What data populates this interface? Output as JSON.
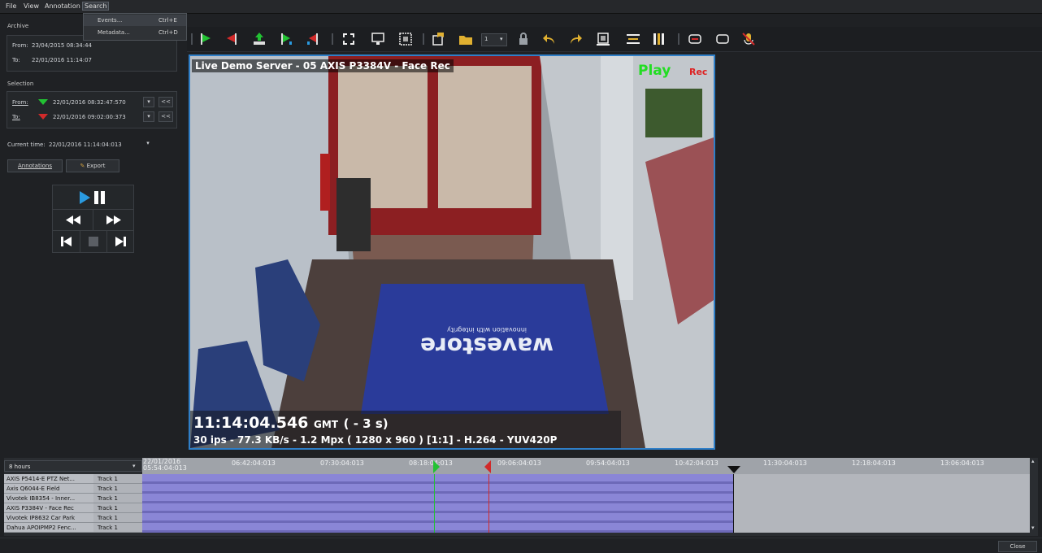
{
  "menubar": {
    "items": [
      "File",
      "View",
      "Annotation",
      "Search"
    ]
  },
  "search_menu": {
    "items": [
      {
        "label": "Events...",
        "shortcut": "Ctrl+E"
      },
      {
        "label": "Metadata...",
        "shortcut": "Ctrl+D"
      }
    ]
  },
  "archive": {
    "title": "Archive",
    "from_label": "From:",
    "from_value": "23/04/2015 08:34:44",
    "to_label": "To:",
    "to_value": "22/01/2016 11:14:07"
  },
  "selection": {
    "title": "Selection",
    "from_label": "From:",
    "from_value": "22/01/2016 08:32:47:570",
    "to_label": "To:",
    "to_value": "22/01/2016 09:02:00:373",
    "jump_label": "<<"
  },
  "current_time": {
    "label": "Current time:",
    "value": "22/01/2016 11:14:04:013"
  },
  "buttons": {
    "annotations": "Annotations",
    "export": "Export"
  },
  "toolbar": {
    "page_value": "1"
  },
  "video": {
    "title": "Live Demo Server - 05 AXIS P3384V - Face Rec",
    "play": "Play",
    "rec": "Rec",
    "time": "11:14:04.546",
    "tz": "GMT",
    "offset": "( - 3 s)",
    "stats": "30 ips - 77.3 KB/s - 1.2 Mpx ( 1280 x 960 ) [1:1] - H.264 - YUV420P",
    "mat_brand": "wavestore",
    "mat_tagline": "innovation with integrity"
  },
  "timeline": {
    "range_value": "8 hours",
    "start_date": "22/01/2016",
    "ticks": [
      "05:54:04:013",
      "06:42:04:013",
      "07:30:04:013",
      "08:18:04:013",
      "09:06:04:013",
      "09:54:04:013",
      "10:42:04:013",
      "11:30:04:013",
      "12:18:04:013",
      "13:06:04:013"
    ],
    "rows": [
      {
        "name": "AXIS P5414-E PTZ Net...",
        "track": "Track 1"
      },
      {
        "name": "Axis Q6044-E Field",
        "track": "Track 1"
      },
      {
        "name": "Vivotek IB8354 - Inner...",
        "track": "Track 1"
      },
      {
        "name": "AXIS P3384V - Face Rec",
        "track": "Track 1"
      },
      {
        "name": "Vivotek IP8632 Car Park",
        "track": "Track 1"
      },
      {
        "name": "Dahua APOIPMP2 Fenc...",
        "track": "Track 1"
      }
    ]
  },
  "footer": {
    "close": "Close"
  },
  "colors": {
    "accent": "#2f7fc8",
    "play": "#22dd22",
    "rec": "#dd2222",
    "track_fill": "#8a86d6"
  }
}
